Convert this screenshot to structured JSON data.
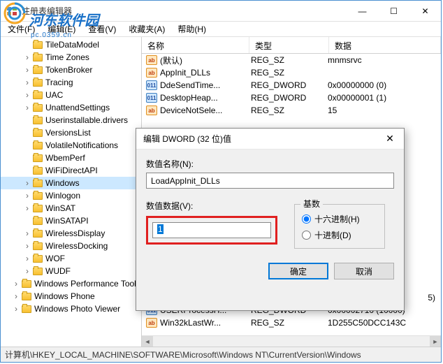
{
  "watermark": {
    "brand": "河东软件园",
    "url": "pc.0359.cn"
  },
  "window": {
    "title": "注册表编辑器",
    "menu": {
      "file": "文件(F)",
      "edit": "编辑(E)",
      "view": "查看(V)",
      "favorites": "收藏夹(A)",
      "help": "帮助(H)"
    }
  },
  "tree": [
    {
      "label": "TileDataModel",
      "depth": 2,
      "exp": ""
    },
    {
      "label": "Time Zones",
      "depth": 2,
      "exp": ">"
    },
    {
      "label": "TokenBroker",
      "depth": 2,
      "exp": ">"
    },
    {
      "label": "Tracing",
      "depth": 2,
      "exp": ">"
    },
    {
      "label": "UAC",
      "depth": 2,
      "exp": ">"
    },
    {
      "label": "UnattendSettings",
      "depth": 2,
      "exp": ">"
    },
    {
      "label": "Userinstallable.drivers",
      "depth": 2,
      "exp": ""
    },
    {
      "label": "VersionsList",
      "depth": 2,
      "exp": ""
    },
    {
      "label": "VolatileNotifications",
      "depth": 2,
      "exp": ""
    },
    {
      "label": "WbemPerf",
      "depth": 2,
      "exp": ""
    },
    {
      "label": "WiFiDirectAPI",
      "depth": 2,
      "exp": ""
    },
    {
      "label": "Windows",
      "depth": 2,
      "exp": ">",
      "selected": true
    },
    {
      "label": "Winlogon",
      "depth": 2,
      "exp": ">"
    },
    {
      "label": "WinSAT",
      "depth": 2,
      "exp": ">"
    },
    {
      "label": "WinSATAPI",
      "depth": 2,
      "exp": ""
    },
    {
      "label": "WirelessDisplay",
      "depth": 2,
      "exp": ">"
    },
    {
      "label": "WirelessDocking",
      "depth": 2,
      "exp": ">"
    },
    {
      "label": "WOF",
      "depth": 2,
      "exp": ">"
    },
    {
      "label": "WUDF",
      "depth": 2,
      "exp": ">"
    },
    {
      "label": "Windows Performance Toolk",
      "depth": 1,
      "exp": ">"
    },
    {
      "label": "Windows Phone",
      "depth": 1,
      "exp": ">"
    },
    {
      "label": "Windows Photo Viewer",
      "depth": 1,
      "exp": ">"
    }
  ],
  "listHeader": {
    "name": "名称",
    "type": "类型",
    "data": "数据"
  },
  "values": [
    {
      "icon": "sz",
      "name": "(默认)",
      "type": "REG_SZ",
      "data": "mnmsrvc"
    },
    {
      "icon": "sz",
      "name": "AppInit_DLLs",
      "type": "REG_SZ",
      "data": ""
    },
    {
      "icon": "dw",
      "name": "DdeSendTime...",
      "type": "REG_DWORD",
      "data": "0x00000000 (0)"
    },
    {
      "icon": "dw",
      "name": "DesktopHeap...",
      "type": "REG_DWORD",
      "data": "0x00000001 (1)"
    },
    {
      "icon": "sz",
      "name": "DeviceNotSele...",
      "type": "REG_SZ",
      "data": "15"
    },
    {
      "icon": "dw",
      "name": "USERProcessH...",
      "type": "REG_DWORD",
      "data": "0x00002710 (10000)"
    },
    {
      "icon": "sz",
      "name": "Win32kLastWr...",
      "type": "REG_SZ",
      "data": "1D255C50DCC143C"
    }
  ],
  "statusbar": "计算机\\HKEY_LOCAL_MACHINE\\SOFTWARE\\Microsoft\\Windows NT\\CurrentVersion\\Windows",
  "dialog": {
    "title": "编辑 DWORD (32 位)值",
    "nameLabel": "数值名称(N):",
    "nameValue": "LoadAppInit_DLLs",
    "dataLabel": "数值数据(V):",
    "dataValue": "1",
    "baseLabel": "基数",
    "hexLabel": "十六进制(H)",
    "decLabel": "十进制(D)",
    "ok": "确定",
    "cancel": "取消"
  },
  "hiddenRowTail": "5)"
}
